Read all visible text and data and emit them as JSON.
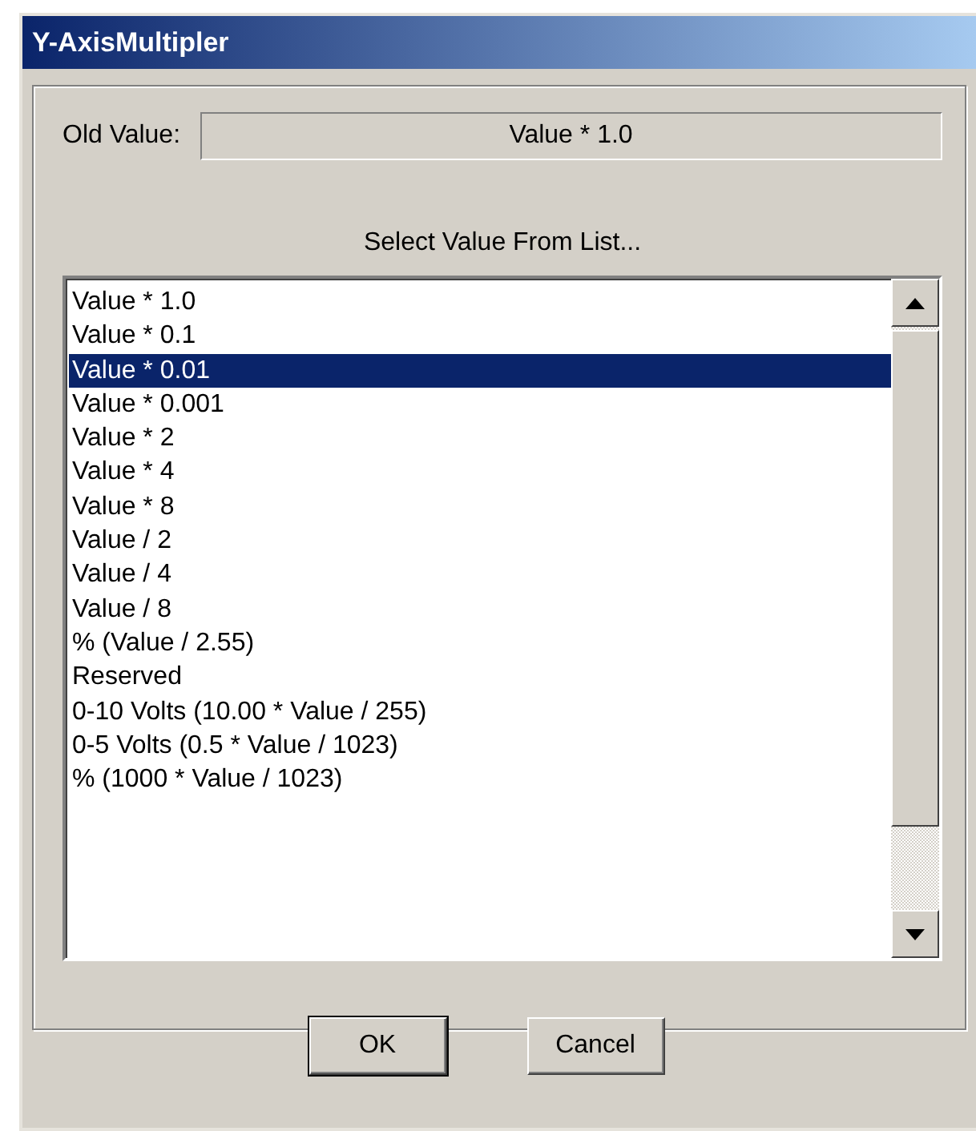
{
  "window": {
    "title": "Y-AxisMultipler"
  },
  "old_value": {
    "label": "Old Value:",
    "value": "Value * 1.0"
  },
  "list_heading": "Select Value From List...",
  "list_items": [
    {
      "label": "Value * 1.0",
      "selected": false
    },
    {
      "label": "Value * 0.1",
      "selected": false
    },
    {
      "label": "Value * 0.01",
      "selected": true
    },
    {
      "label": "Value * 0.001",
      "selected": false
    },
    {
      "label": "Value * 2",
      "selected": false
    },
    {
      "label": "Value * 4",
      "selected": false
    },
    {
      "label": "Value * 8",
      "selected": false
    },
    {
      "label": "Value / 2",
      "selected": false
    },
    {
      "label": "Value / 4",
      "selected": false
    },
    {
      "label": "Value / 8",
      "selected": false
    },
    {
      "label": "% (Value / 2.55)",
      "selected": false
    },
    {
      "label": "Reserved",
      "selected": false
    },
    {
      "label": "0-10 Volts (10.00 * Value / 255)",
      "selected": false
    },
    {
      "label": "0-5 Volts (0.5 * Value / 1023)",
      "selected": false
    },
    {
      "label": "% (1000 * Value / 1023)",
      "selected": false
    }
  ],
  "buttons": [
    "OK",
    "Cancel"
  ]
}
